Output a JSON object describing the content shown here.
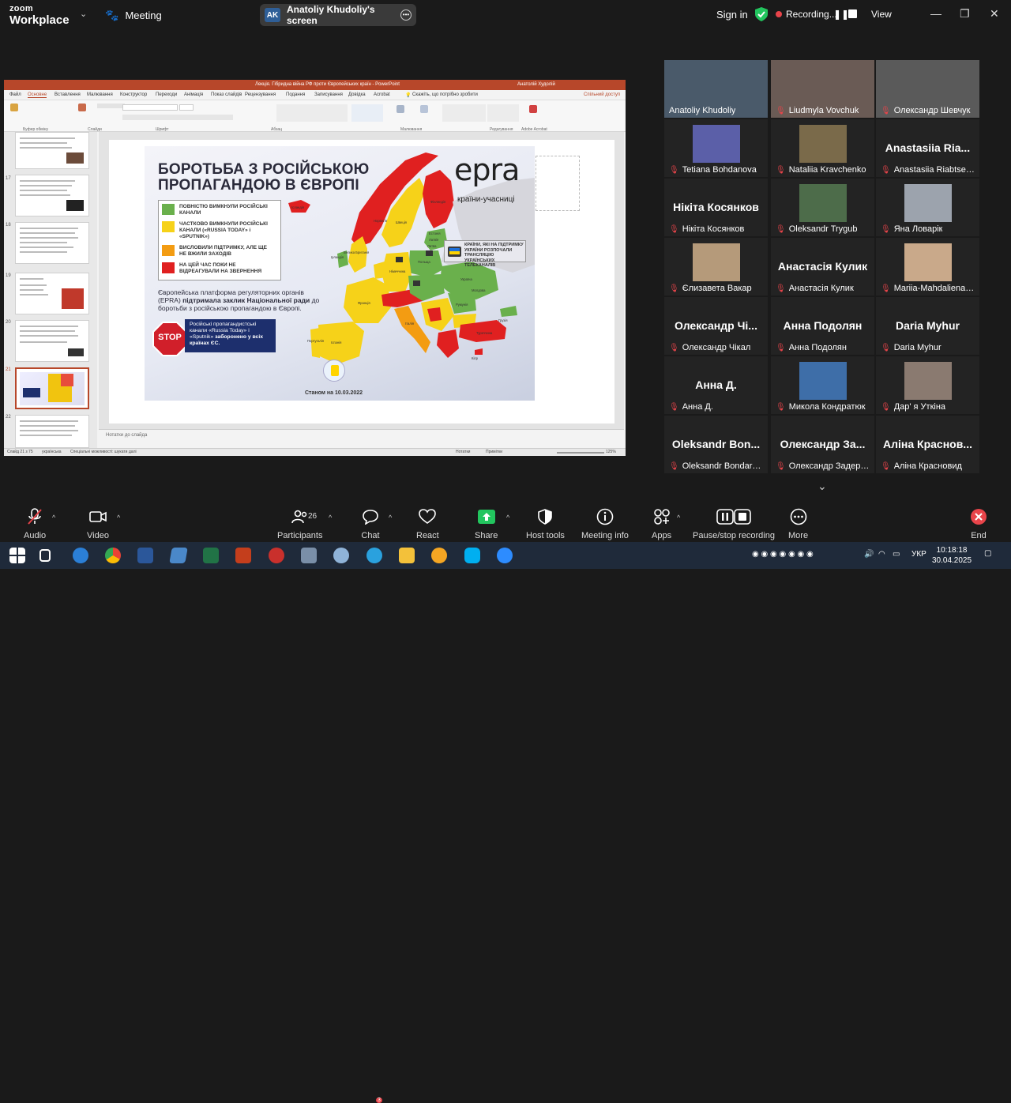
{
  "app": {
    "brand_top": "zoom",
    "brand_bottom": "Workplace",
    "meeting_label": "Meeting"
  },
  "share": {
    "initials": "AK",
    "title": "Anatoliy Khudoliy's screen"
  },
  "topright": {
    "signin": "Sign in",
    "recording": "Recording...",
    "view": "View"
  },
  "ppt": {
    "title": "Лекція. Гібридна війна РФ проти Європейських країн  -  PowerPoint",
    "user": "Анатолій Худолій",
    "search": "Скажіть, що потрібно зробити",
    "share_btn": "Спільний доступ",
    "tabs": [
      "Файл",
      "Основне",
      "Вставлення",
      "Малювання",
      "Конструктор",
      "Переходи",
      "Анімація",
      "Показ слайдів",
      "Рецензування",
      "Подання",
      "Записування",
      "Довідка",
      "Acrobat"
    ],
    "groups": [
      "Буфер обміну",
      "Слайди",
      "Шрифт",
      "Абзац",
      "Малювання",
      "Редагування",
      "Adobe Acrobat"
    ],
    "slide_numbers": [
      "17",
      "18",
      "19",
      "20",
      "21",
      "22"
    ],
    "notes": "Нотатки до слайда",
    "status_left": "Слайд 21 з 75",
    "status_lang": "українська",
    "status_access": "Спеціальні можливості: шукати далі",
    "status_notes": "Нотатки",
    "status_comments": "Примітки",
    "status_zoom": "125%"
  },
  "slide": {
    "title_line1": "БОРОТЬБА З РОСІЙСЬКОЮ",
    "title_line2": "ПРОПАГАНДОЮ В ЄВРОПІ",
    "logo": "epra",
    "logo_sub": "країни-учасниці",
    "legend": [
      {
        "color": "#6ab04c",
        "text": "ПОВНІСТЮ ВИМКНУЛИ РОСІЙСЬКІ КАНАЛИ"
      },
      {
        "color": "#f6d219",
        "text": "ЧАСТКОВО ВИМКНУЛИ РОСІЙСЬКІ КАНАЛИ («RUSSIA TODAY» і «SPUTNIK»)"
      },
      {
        "color": "#f39c12",
        "text": "ВИСЛОВИЛИ ПІДТРИМКУ, АЛЕ ЩЕ НЕ ВЖИЛИ ЗАХОДІВ"
      },
      {
        "color": "#e02020",
        "text": "НА ЦЕЙ ЧАС ПОКИ НЕ ВІДРЕАГУВАЛИ НА ЗВЕРНЕННЯ"
      }
    ],
    "tv_note": "КРАЇНИ, ЯКІ НА ПІДТРИМКУ УКРАЇНИ РОЗПОЧАЛИ ТРАНСЛЯЦІЮ УКРАЇНСЬКИХ ТЕЛЕКАНАЛІВ",
    "epra_text_1": "Європейська платформа регуляторних органів (EPRA) ",
    "epra_text_bold": "підтримала заклик Національної ради",
    "epra_text_2": " до боротьби з російською пропагандою в Європі.",
    "stop": "STOP",
    "rt_1": "Російські пропагандистські канали «Russia Today» і «Sputnik» ",
    "rt_bold": "заборонено у всіх країнах ЄС.",
    "date": "Станом на 10.03.2022",
    "map_labels": [
      "Ісландія",
      "Норвегія",
      "Швеція",
      "Фінляндія",
      "Естонія",
      "Латвія",
      "Литва",
      "Білорусь",
      "Україна",
      "Польща",
      "Німеччина",
      "Франція",
      "Іспанія",
      "Португалія",
      "Італія",
      "Ірландія",
      "Велика Британія",
      "Туреччина",
      "Грузія",
      "Кіпр",
      "Румунія",
      "Молдова"
    ]
  },
  "participants": [
    {
      "name": "Anatoliy Khudoliy",
      "big": "",
      "active": true,
      "photo": "#4a5a6a",
      "muted": false
    },
    {
      "name": "Liudmyla Vovchuk",
      "big": "",
      "active": false,
      "photo": "#6a5b55",
      "muted": true
    },
    {
      "name": "Олександр Шевчук",
      "big": "",
      "active": false,
      "photo": "#5a5a5a",
      "muted": true
    },
    {
      "name": "Tetiana Bohdanova",
      "big": "",
      "active": false,
      "photo": "#5b5fa8",
      "muted": true
    },
    {
      "name": "Nataliia Kravchenko",
      "big": "",
      "active": false,
      "photo": "#7a6a4a",
      "muted": true
    },
    {
      "name": "Anastasiia Riabtsev...",
      "big": "Anastasiia Ria...",
      "active": false,
      "photo": "",
      "muted": true
    },
    {
      "name": "Нікіта Косянков",
      "big": "Нікіта Косянков",
      "active": false,
      "photo": "",
      "muted": true
    },
    {
      "name": "Oleksandr Trygub",
      "big": "",
      "active": false,
      "photo": "#4d6c4a",
      "muted": true
    },
    {
      "name": "Яна Ловарік",
      "big": "",
      "active": false,
      "photo": "#9ca3ad",
      "muted": true
    },
    {
      "name": "Єлизавета Вакар",
      "big": "",
      "active": false,
      "photo": "#b59a7a",
      "muted": true
    },
    {
      "name": "Анастасія Кулик",
      "big": "Анастасія Кулик",
      "active": false,
      "photo": "",
      "muted": true
    },
    {
      "name": "Mariia-Mahdaliena B...",
      "big": "",
      "active": false,
      "photo": "#c9a98a",
      "muted": true
    },
    {
      "name": "Олександр Чікал",
      "big": "Олександр Чі...",
      "active": false,
      "photo": "",
      "muted": true
    },
    {
      "name": "Анна Подолян",
      "big": "Анна Подолян",
      "active": false,
      "photo": "",
      "muted": true
    },
    {
      "name": "Daria Myhur",
      "big": "Daria Myhur",
      "active": false,
      "photo": "",
      "muted": true
    },
    {
      "name": "Анна Д.",
      "big": "Анна Д.",
      "active": false,
      "photo": "",
      "muted": true
    },
    {
      "name": "Микола Кондратюк",
      "big": "",
      "active": false,
      "photo": "#3e6ea8",
      "muted": true
    },
    {
      "name": "Дар' я Уткіна",
      "big": "",
      "active": false,
      "photo": "#8a7a70",
      "muted": true
    },
    {
      "name": "Oleksandr Bondarev...",
      "big": "Oleksandr Bon...",
      "active": false,
      "photo": "",
      "muted": true
    },
    {
      "name": "Олександр Задерні...",
      "big": "Олександр За...",
      "active": false,
      "photo": "",
      "muted": true
    },
    {
      "name": "Аліна Красновид",
      "big": "Аліна Краснов...",
      "active": false,
      "photo": "",
      "muted": true
    }
  ],
  "toolbar": {
    "audio": "Audio",
    "video": "Video",
    "participants": "Participants",
    "participants_count": "26",
    "chat": "Chat",
    "react": "React",
    "share": "Share",
    "host_tools": "Host tools",
    "meeting_info": "Meeting info",
    "apps": "Apps",
    "pause_rec": "Pause/stop recording",
    "more": "More",
    "end": "End"
  },
  "taskbar": {
    "lang": "УКР",
    "time": "10:18:18",
    "date": "30.04.2025",
    "notify_badge": "3"
  }
}
